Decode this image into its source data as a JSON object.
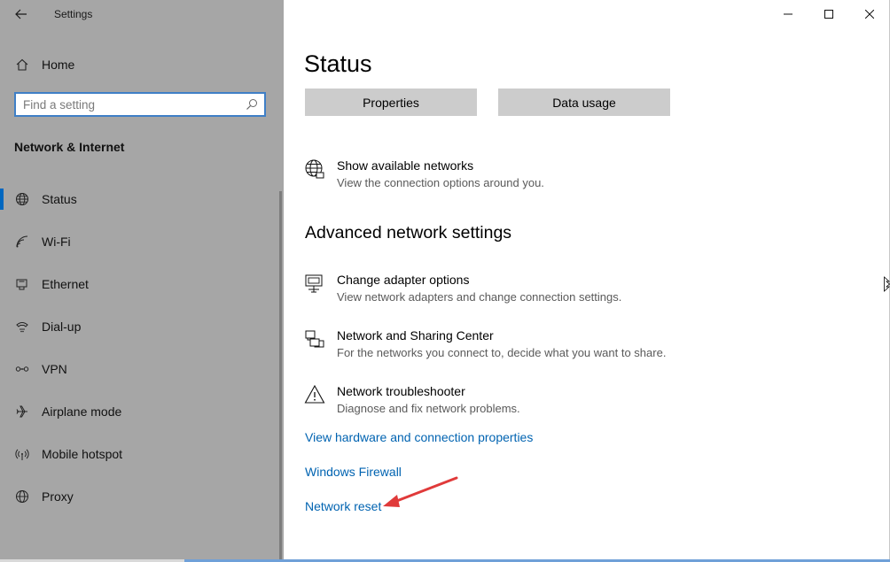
{
  "app": {
    "title": "Settings"
  },
  "sidebar": {
    "home_label": "Home",
    "search_placeholder": "Find a setting",
    "section_title": "Network & Internet",
    "items": [
      {
        "label": "Status",
        "icon": "globe-network-icon",
        "active": true
      },
      {
        "label": "Wi-Fi",
        "icon": "wifi-icon",
        "active": false
      },
      {
        "label": "Ethernet",
        "icon": "ethernet-icon",
        "active": false
      },
      {
        "label": "Dial-up",
        "icon": "dialup-icon",
        "active": false
      },
      {
        "label": "VPN",
        "icon": "vpn-icon",
        "active": false
      },
      {
        "label": "Airplane mode",
        "icon": "airplane-icon",
        "active": false
      },
      {
        "label": "Mobile hotspot",
        "icon": "hotspot-icon",
        "active": false
      },
      {
        "label": "Proxy",
        "icon": "globe-icon",
        "active": false
      }
    ]
  },
  "main": {
    "title": "Status",
    "buttons": {
      "properties": "Properties",
      "data_usage": "Data usage"
    },
    "show_networks": {
      "title": "Show available networks",
      "desc": "View the connection options around you."
    },
    "advanced_heading": "Advanced network settings",
    "advanced_items": [
      {
        "title": "Change adapter options",
        "desc": "View network adapters and change connection settings.",
        "icon": "adapter-icon"
      },
      {
        "title": "Network and Sharing Center",
        "desc": "For the networks you connect to, decide what you want to share.",
        "icon": "sharing-center-icon"
      },
      {
        "title": "Network troubleshooter",
        "desc": "Diagnose and fix network problems.",
        "icon": "warning-icon"
      }
    ],
    "links": {
      "hardware": "View hardware and connection properties",
      "firewall": "Windows Firewall",
      "reset": "Network reset"
    }
  },
  "colors": {
    "sidebar_bg": "#a6a6a6",
    "accent": "#0067c0",
    "link": "#0063b1",
    "annotation_arrow": "#e03a3a"
  }
}
